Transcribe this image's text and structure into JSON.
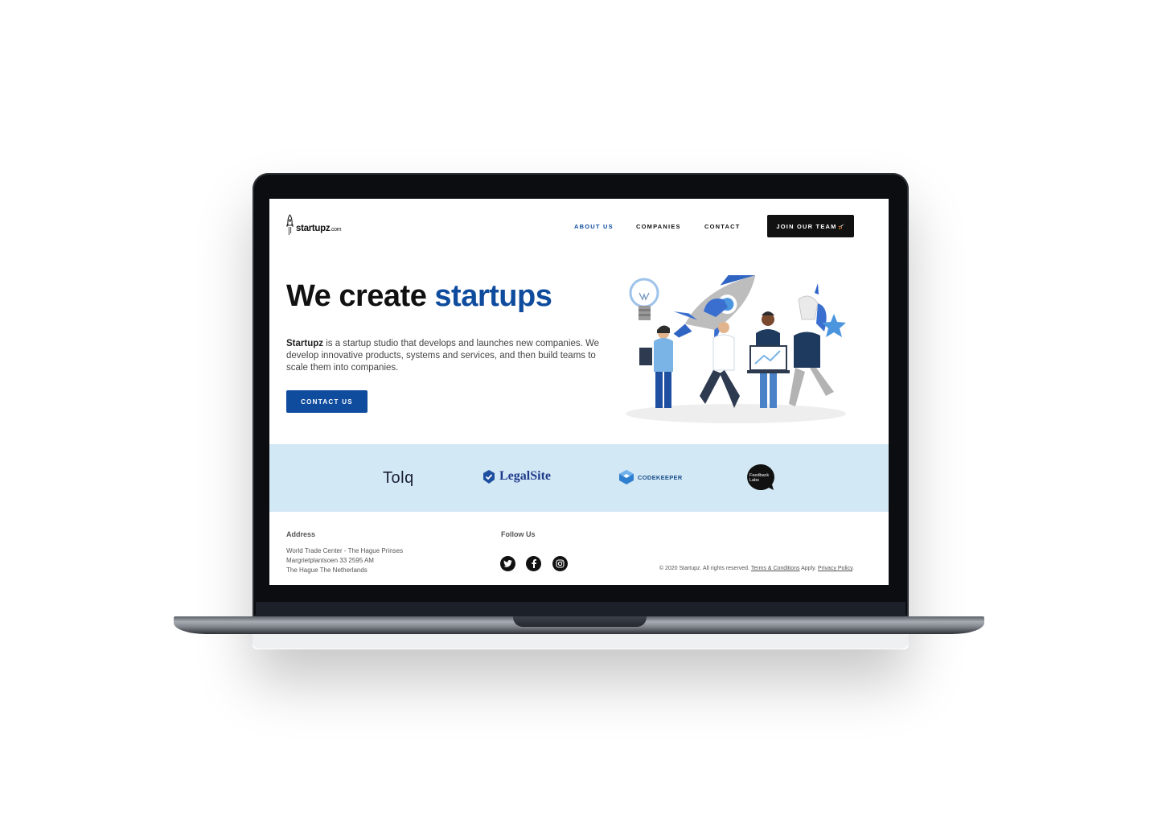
{
  "brand": {
    "name": "startupz",
    "suffix": ".com",
    "icon": "rocket-icon"
  },
  "nav": {
    "items": [
      {
        "label": "ABOUT US",
        "active": true
      },
      {
        "label": "COMPANIES",
        "active": false
      },
      {
        "label": "CONTACT",
        "active": false
      }
    ],
    "cta_label": "JOIN OUR TEAM",
    "cta_icon": "rocket-emoji-icon"
  },
  "hero": {
    "title_prefix": "We create ",
    "title_accent": "startups",
    "description_strong": "Startupz",
    "description_rest": " is a startup studio that develops and launches new companies. We develop innovative products, systems and services, and then build teams to scale them into companies.",
    "cta_label": "CONTACT US"
  },
  "partners": {
    "tolq": "Tolq",
    "legalsite": "LegalSite",
    "codekeeper": "CODEKEEPER",
    "feedback_line1": "Feedback",
    "feedback_line2": "Labs"
  },
  "footer": {
    "address_heading": "Address",
    "address_lines": [
      "World Trade Center - The Hague Prinses",
      "Margrietplantsoen 33 2595 AM",
      "The Hague The Netherlands"
    ],
    "follow_heading": "Follow Us",
    "social": [
      "twitter-icon",
      "facebook-icon",
      "instagram-icon"
    ],
    "copyright_text": "© 2020 Startupz. All rights reserved.",
    "terms_label": "Terms & Conditions",
    "apply_text": "Apply.",
    "privacy_label": "Privacy Policy",
    "privacy_suffix": "."
  },
  "colors": {
    "accent": "#0f4c9e",
    "band": "#d3e8f5",
    "dark": "#111111"
  }
}
